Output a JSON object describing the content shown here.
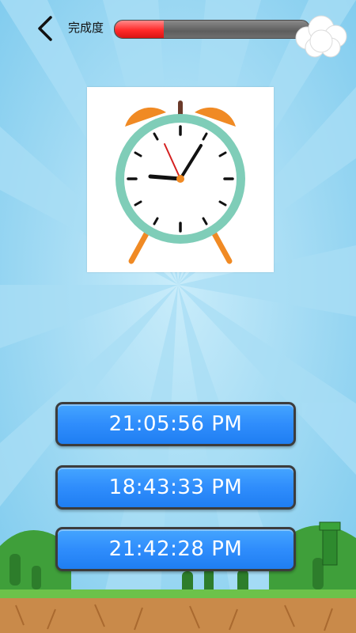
{
  "header": {
    "back_icon": "chevron-left-icon",
    "progress_label": "完成度",
    "progress_fraction": 0.25,
    "cloud_icon": "cloud-icon"
  },
  "question": {
    "clock_icon": "alarm-clock-icon",
    "clock_colors": {
      "bells": "#f08a24",
      "rim": "#7fcdb8",
      "legs": "#f08a24",
      "second_hand": "#d42020"
    }
  },
  "answers": [
    {
      "label": "21:05:56 PM"
    },
    {
      "label": "18:43:33 PM"
    },
    {
      "label": "21:42:28 PM"
    }
  ],
  "colors": {
    "sky": "#8fd3f0",
    "button": "#2f8dfc",
    "progress_fill": "#ff2a2a"
  }
}
